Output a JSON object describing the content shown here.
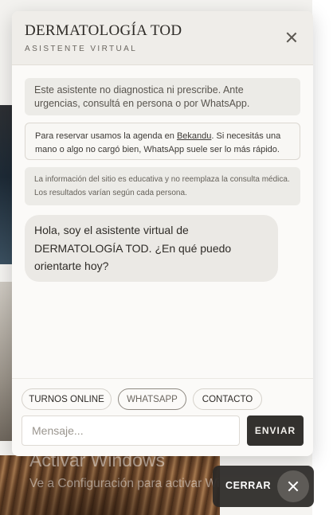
{
  "chat": {
    "title": "DERMATOLOGÍA TOD",
    "subtitle": "ASISTENTE VIRTUAL",
    "close_icon": "close-icon"
  },
  "notices": {
    "disclaimer": "Este asistente no diagnostica ni prescribe. Ante urgencias, consultá en persona o por WhatsApp.",
    "booking_prefix": "Para reservar usamos la agenda en ",
    "booking_link": "Bekandu",
    "booking_suffix": ". Si necesitás una mano o algo no cargó bien, WhatsApp suele ser lo más rápido.",
    "info": "La información del sitio es educativa y no reemplaza la consulta médica. Los resultados varían según cada persona."
  },
  "greeting": "Hola, soy el asistente virtual de DERMATOLOGÍA TOD. ¿En qué puedo orientarte hoy?",
  "quick_replies": [
    "TURNOS ONLINE",
    "WHATSAPP",
    "CONTACTO"
  ],
  "composer": {
    "placeholder": "Mensaje...",
    "value": "",
    "send_label": "ENVIAR"
  },
  "watermark": {
    "title": "Activar Windows",
    "subtitle": "Ve a Configuración para activar Windows."
  },
  "close_button": {
    "label": "CERRAR",
    "icon": "close-icon"
  },
  "colors": {
    "header_bg": "#efede9",
    "panel_bg": "#fbfaf8",
    "send_bg": "#33312e",
    "bubble_bg": "#ebe9e5"
  }
}
